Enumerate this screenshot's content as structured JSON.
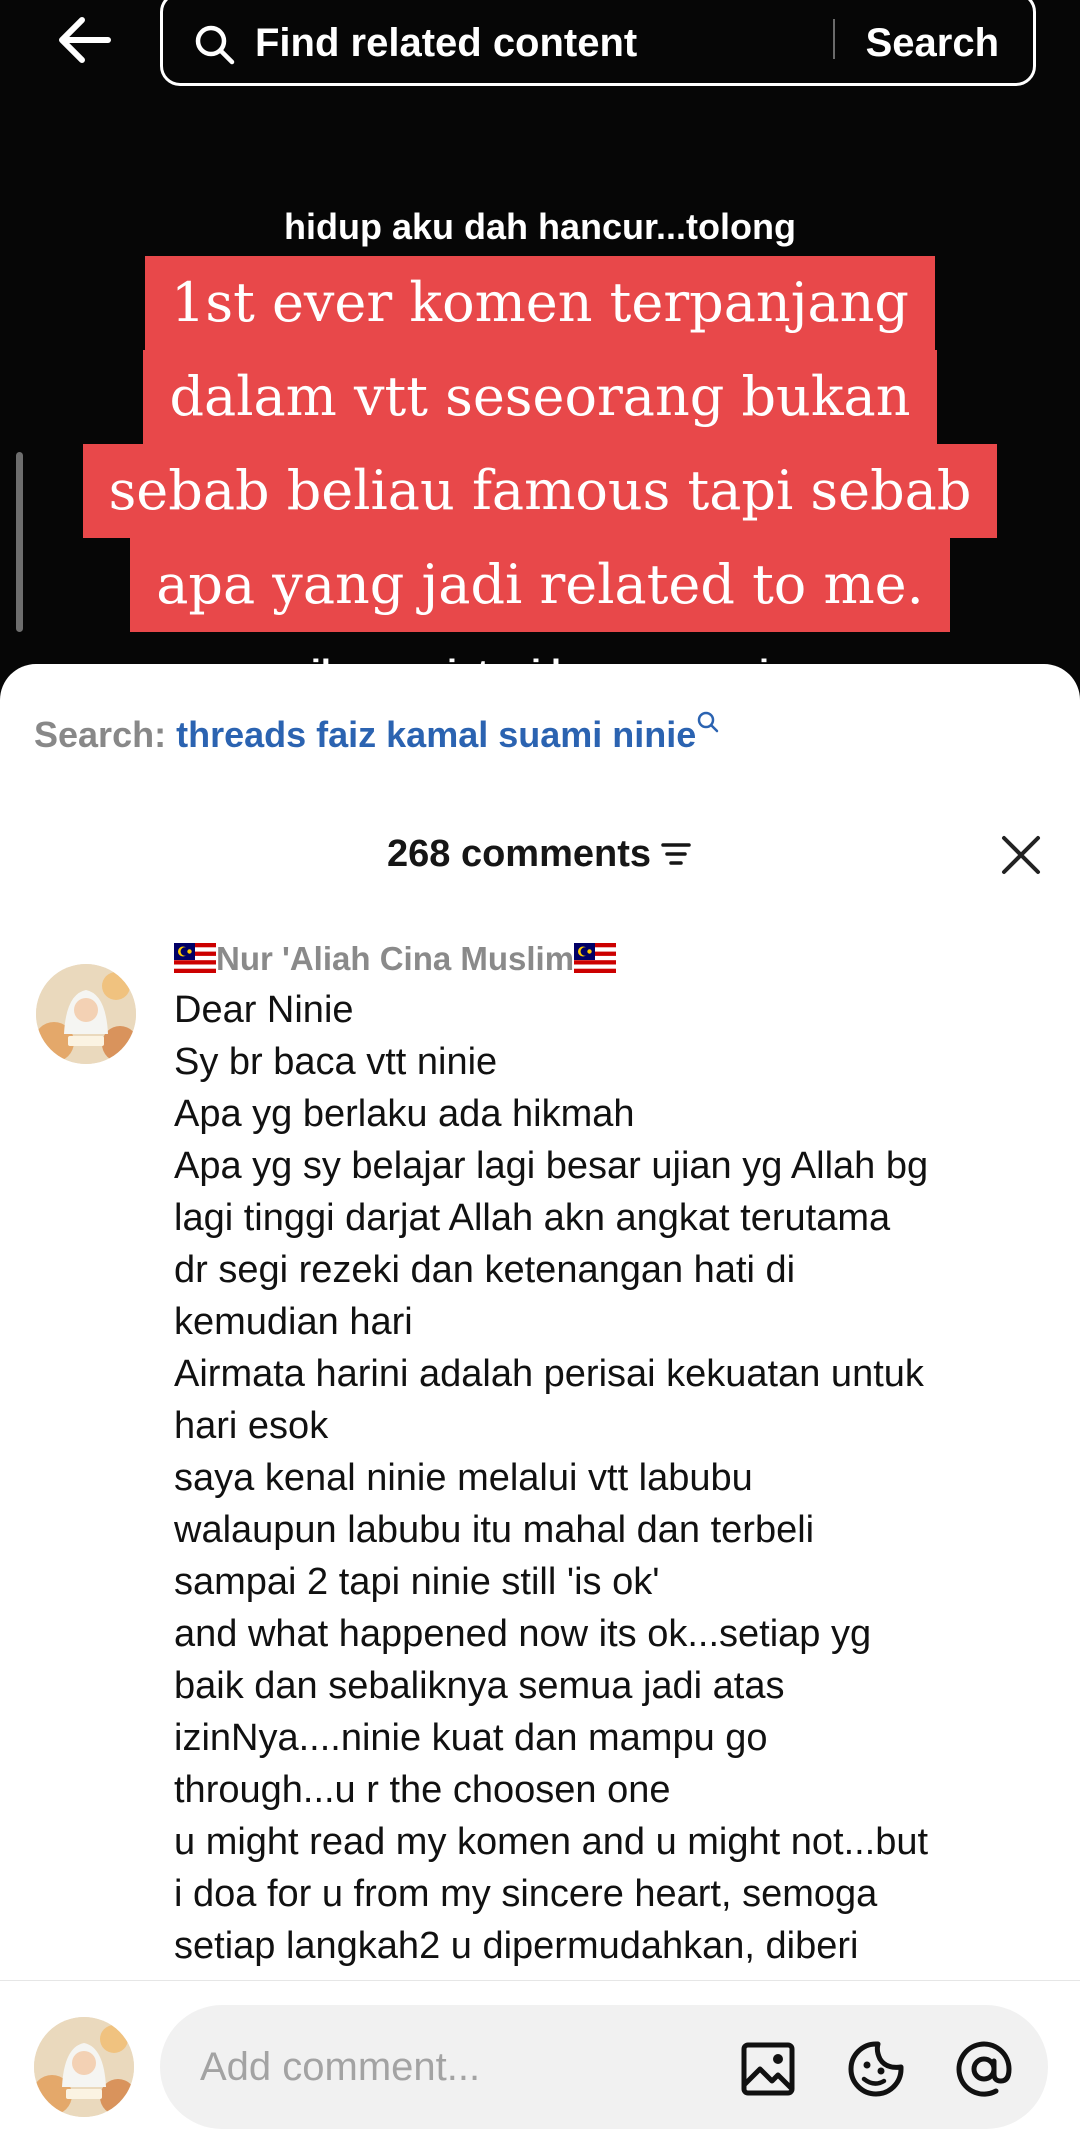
{
  "search": {
    "placeholder": "Find related content",
    "button": "Search"
  },
  "video": {
    "top_caption": "hidup aku dah hancur...tolong",
    "overlay_lines": [
      "1st ever komen terpanjang",
      "dalam vtt seseorang bukan",
      "sebab beliau famous tapi sebab",
      "apa yang jadi related to me."
    ],
    "bottom_caption": "sih suami, tapi kau senang je"
  },
  "sheet": {
    "search_label": "Search:",
    "search_term": "threads faiz kamal suami ninie",
    "comment_count": "268 comments"
  },
  "comment": {
    "username": "Nur 'Aliah Cina Muslim",
    "lines": [
      "Dear Ninie",
      "Sy br baca vtt ninie",
      "Apa yg berlaku ada hikmah",
      "Apa yg sy belajar lagi besar ujian yg Allah bg",
      "lagi tinggi darjat Allah akn angkat terutama",
      "dr segi rezeki dan ketenangan hati di",
      "kemudian hari",
      "Airmata harini adalah perisai kekuatan untuk",
      "hari esok",
      "saya kenal ninie melalui vtt labubu",
      "walaupun labubu itu mahal dan terbeli",
      "sampai 2 tapi ninie still 'is ok'",
      "and what happened now its ok...setiap yg",
      "baik dan sebaliknya semua jadi atas",
      "izinNya....ninie kuat dan mampu go",
      "through...u r the choosen one",
      "u might read my komen and u might not...but",
      "i doa for u from my sincere heart, semoga",
      "setiap langkah2 u dipermudahkan, diberi"
    ]
  },
  "input": {
    "placeholder": "Add comment..."
  },
  "icons": {
    "back": "arrow-left-icon",
    "search": "search-icon",
    "filter": "filter-icon",
    "close": "close-icon",
    "image": "image-icon",
    "sticker": "sticker-icon",
    "mention": "mention-icon"
  },
  "colors": {
    "overlay_red": "#e8484a",
    "link_blue": "#2b63b1"
  }
}
